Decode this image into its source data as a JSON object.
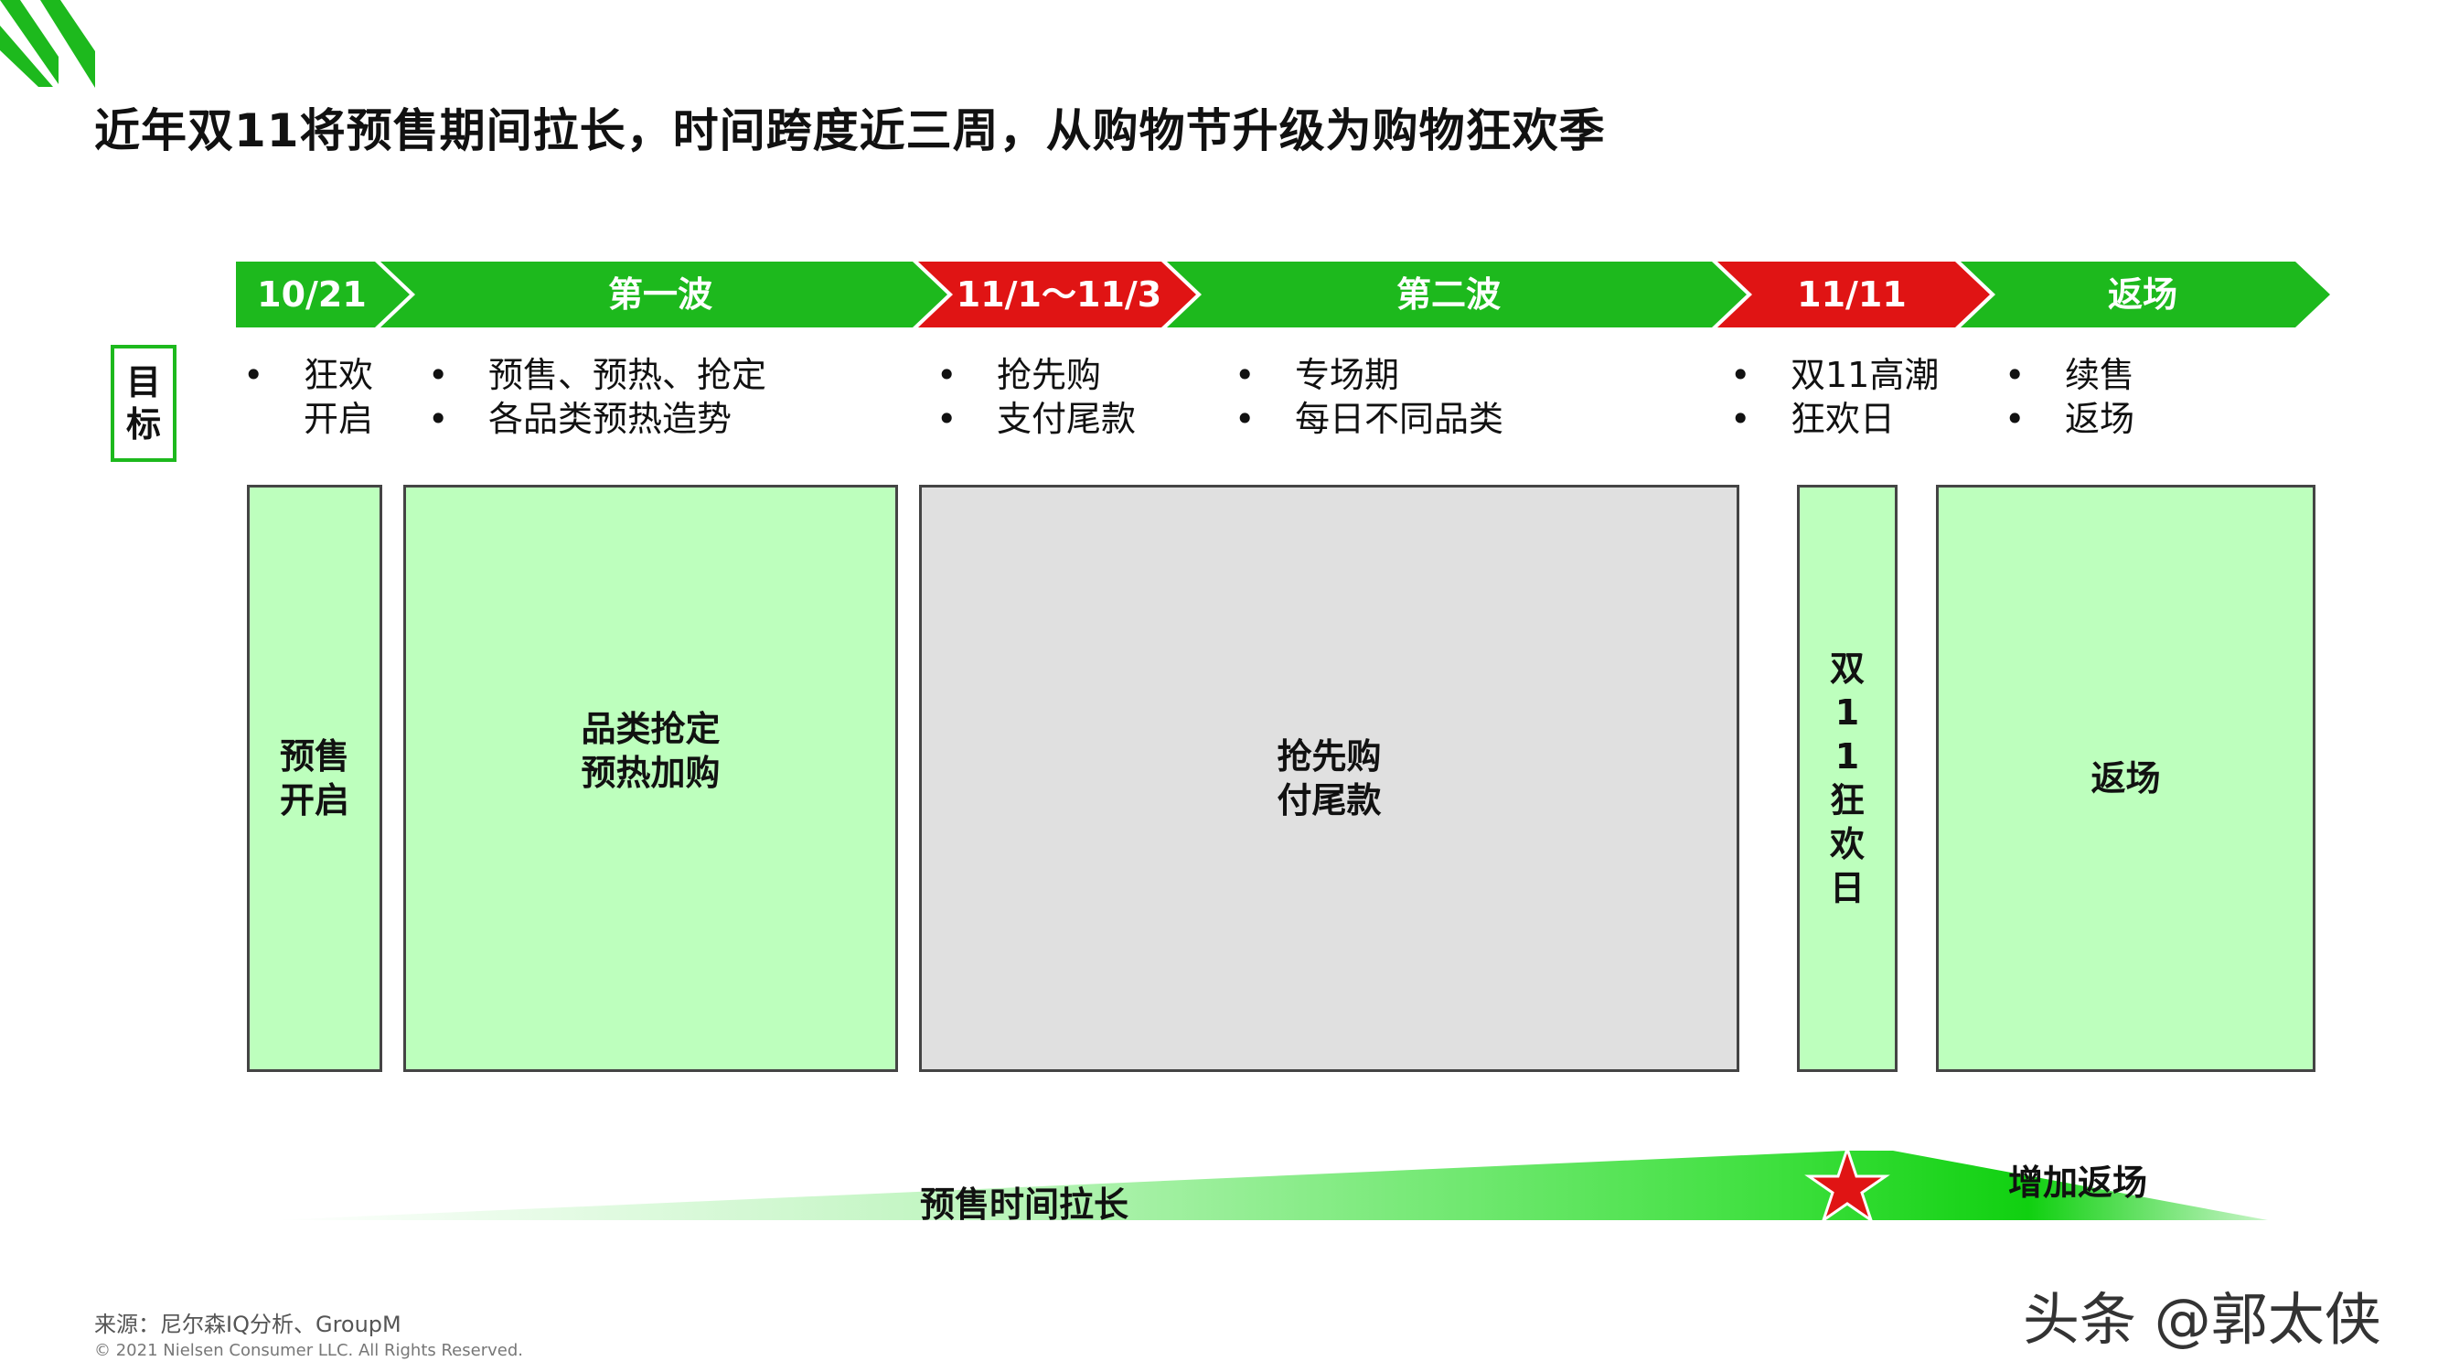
{
  "title": "近年双11将预售期间拉长，时间跨度近三周，从购物节升级为购物狂欢季",
  "colors": {
    "green": "#1db91d",
    "red": "#e01414",
    "light_green": "#bdffbd",
    "gray": "#e0e0e0"
  },
  "phases": [
    {
      "label": "10/21",
      "color": "green"
    },
    {
      "label": "第一波",
      "color": "green"
    },
    {
      "label": "11/1～11/3",
      "color": "red"
    },
    {
      "label": "第二波",
      "color": "green"
    },
    {
      "label": "11/11",
      "color": "red"
    },
    {
      "label": "返场",
      "color": "green"
    }
  ],
  "goal": {
    "label_1": "目",
    "label_2": "标",
    "columns": [
      {
        "line1": "狂欢",
        "line2": "开启"
      },
      {
        "line1": "预售、预热、抢定",
        "line2": "各品类预热造势"
      },
      {
        "line1": "抢先购",
        "line2": "支付尾款"
      },
      {
        "line1": "专场期",
        "line2": "每日不同品类"
      },
      {
        "line1": "双11高潮",
        "line2": "狂欢日"
      },
      {
        "line1": "续售",
        "line2": "返场"
      }
    ]
  },
  "stages": [
    {
      "line1": "预售",
      "line2": "开启"
    },
    {
      "line1": "品类抢定",
      "line2": "预热加购"
    },
    {
      "line1": "抢先购",
      "line2": "付尾款"
    },
    {
      "text": "双11狂欢日"
    },
    {
      "line1": "返场",
      "line2": ""
    }
  ],
  "trend": {
    "left_label": "预售时间拉长",
    "right_label": "增加返场",
    "marker": "star-icon"
  },
  "footer": {
    "source": "来源：尼尔森IQ分析、GroupM",
    "copyright": "© 2021 Nielsen Consumer LLC. All Rights Reserved."
  },
  "watermark": "头条 @郭太侠"
}
